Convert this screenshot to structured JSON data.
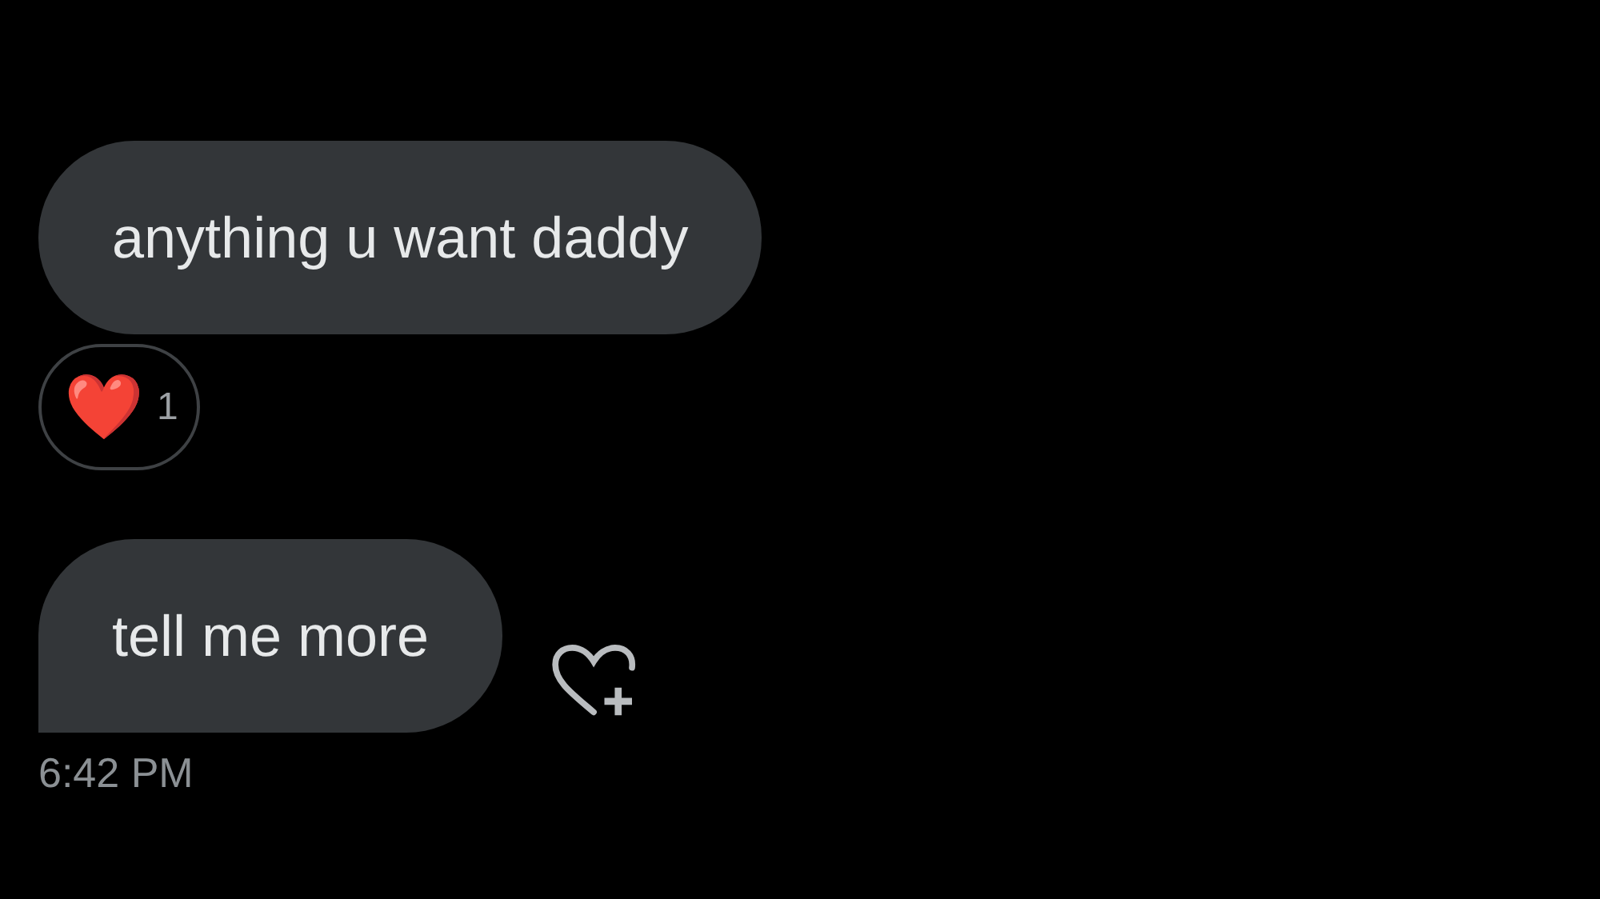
{
  "messages": [
    {
      "text": "anything u want daddy",
      "last_in_group": false,
      "reactions": [
        {
          "emoji": "❤️",
          "count": "1"
        }
      ]
    },
    {
      "text": "tell me more",
      "last_in_group": true,
      "react_button": true,
      "time": "6:42 PM"
    }
  ]
}
